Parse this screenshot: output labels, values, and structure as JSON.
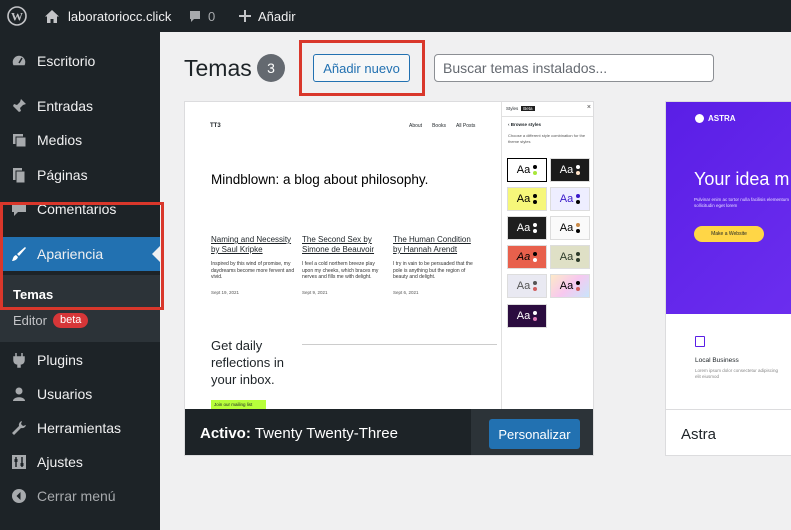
{
  "adminbar": {
    "site_name": "laboratoriocc.click",
    "comments_count": "0",
    "add_label": "Añadir"
  },
  "sidebar": {
    "items": [
      {
        "label": "Escritorio",
        "icon": "dashboard-icon"
      },
      {
        "label": "Entradas",
        "icon": "pin-icon"
      },
      {
        "label": "Medios",
        "icon": "media-icon"
      },
      {
        "label": "Páginas",
        "icon": "pages-icon"
      },
      {
        "label": "Comentarios",
        "icon": "comment-icon"
      },
      {
        "label": "Apariencia",
        "icon": "brush-icon"
      },
      {
        "label": "Plugins",
        "icon": "plugin-icon"
      },
      {
        "label": "Usuarios",
        "icon": "user-icon"
      },
      {
        "label": "Herramientas",
        "icon": "wrench-icon"
      },
      {
        "label": "Ajustes",
        "icon": "settings-icon"
      },
      {
        "label": "Cerrar menú",
        "icon": "collapse-icon"
      }
    ],
    "submenu": {
      "themes": "Temas",
      "editor": "Editor",
      "editor_badge": "beta"
    }
  },
  "header": {
    "title": "Temas",
    "count": "3",
    "add_new": "Añadir nuevo",
    "search_placeholder": "Buscar temas instalados..."
  },
  "active_theme": {
    "active_prefix": "Activo:",
    "name": "Twenty Twenty-Three",
    "customize": "Personalizar",
    "preview": {
      "logo": "TT3",
      "nav": [
        "About",
        "Books",
        "All Posts"
      ],
      "headline": "Mindblown: a blog about philosophy.",
      "posts": [
        {
          "title": "Naming and Necessity by Saul Kripke",
          "excerpt": "Inspired by this wind of promise, my daydreams become more fervent and vivid.",
          "date": "Sept 19, 2021"
        },
        {
          "title": "The Second Sex by Simone de Beauvoir",
          "excerpt": "I feel a cold northern breeze play upon my cheeks, which braces my nerves and fills me with delight.",
          "date": "Sept 9, 2021"
        },
        {
          "title": "The Human Condition by Hannah Arendt",
          "excerpt": "I try in vain to be persuaded that the pole is anything but the region of beauty and delight.",
          "date": "Sept 6, 2021"
        }
      ],
      "cta": "Get daily reflections in your inbox.",
      "join": "Join our mailing list",
      "styles_title": "Styles",
      "styles_beta": "Beta",
      "browse_styles": "Browse styles",
      "browse_desc": "Choose a different style combination for the theme styles",
      "swatch_text": "Aa"
    }
  },
  "astra_theme": {
    "name": "Astra",
    "logo": "ASTRA",
    "headline": "Your idea m",
    "sub": "Pulvinar enim ac tortor nulla facilisis elementum sollicitudin eget lorem",
    "button": "Make a Website",
    "feature": "Local Business",
    "feature_text": "Lorem ipsum dolor consectetur adipiscing elit eiusmod"
  }
}
